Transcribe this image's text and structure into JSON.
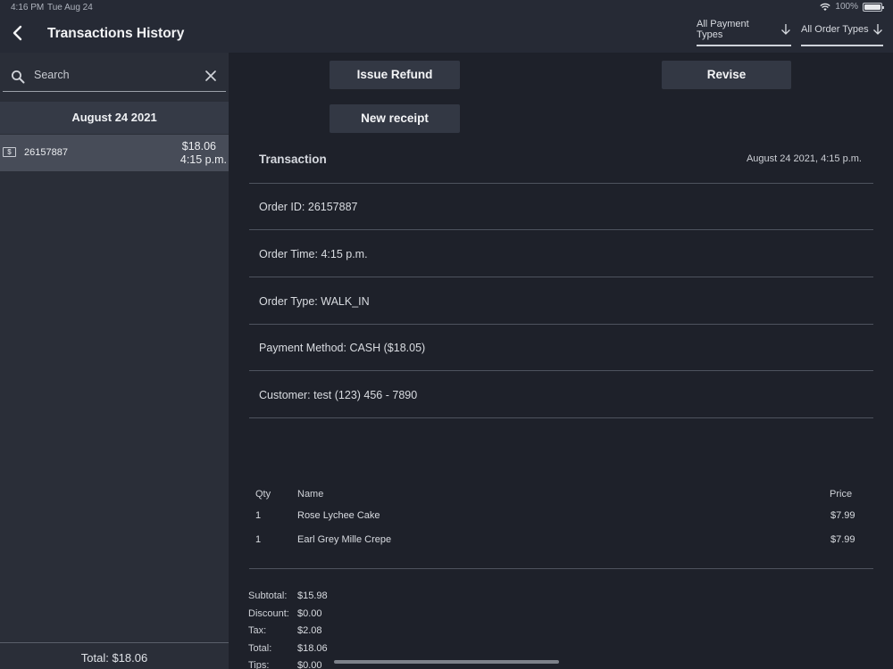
{
  "status_bar": {
    "time": "4:16 PM",
    "date": "Tue Aug 24",
    "battery": "100%"
  },
  "header": {
    "title": "Transactions History",
    "payment_filter": "All Payment Types",
    "order_filter": "All Order Types"
  },
  "sidebar": {
    "search_placeholder": "Search",
    "date_group": "August 24 2021",
    "transactions": [
      {
        "id": "26157887",
        "amount": "$18.06",
        "time": "4:15 p.m."
      }
    ],
    "total": "Total: $18.06"
  },
  "actions": {
    "issue_refund": "Issue Refund",
    "revise": "Revise",
    "new_receipt": "New receipt"
  },
  "transaction": {
    "heading": "Transaction",
    "datetime": "August 24 2021, 4:15 p.m.",
    "order_id": "Order ID: 26157887",
    "order_time": "Order Time: 4:15 p.m.",
    "order_type": "Order Type: WALK_IN",
    "payment_method": "Payment Method: CASH ($18.05)",
    "customer": "Customer: test  (123) 456 - 7890"
  },
  "items_table": {
    "headers": {
      "qty": "Qty",
      "name": "Name",
      "price": "Price"
    },
    "rows": [
      {
        "qty": "1",
        "name": "Rose Lychee Cake",
        "price": "$7.99"
      },
      {
        "qty": "1",
        "name": "Earl Grey Mille Crepe",
        "price": "$7.99"
      }
    ]
  },
  "summary": {
    "subtotal_label": "Subtotal:",
    "subtotal": "$15.98",
    "discount_label": "Discount:",
    "discount": "$0.00",
    "tax_label": "Tax:",
    "tax": "$2.08",
    "total_label": "Total:",
    "total": "$18.06",
    "tips_label": "Tips:",
    "tips": "$0.00"
  }
}
